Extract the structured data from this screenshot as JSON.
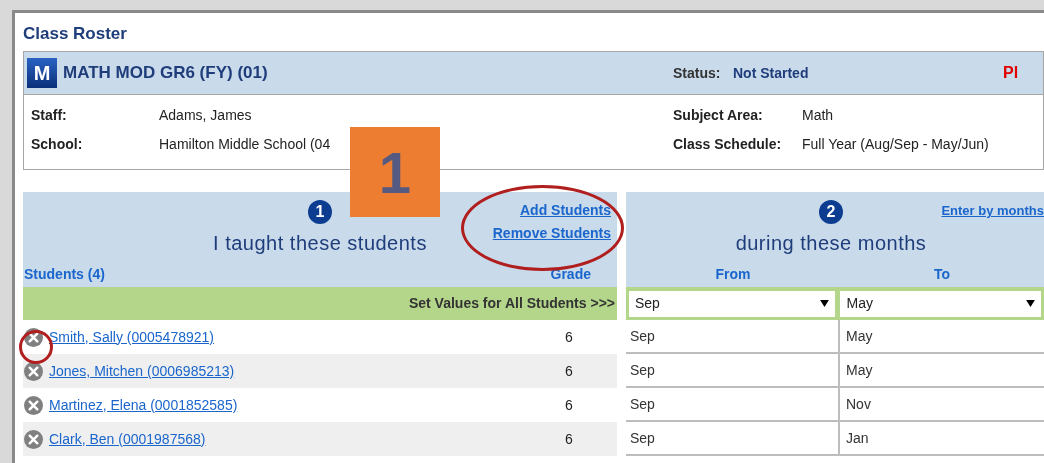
{
  "window": {
    "title": "Class Roster"
  },
  "class_header": {
    "icon_letter": "M",
    "name": "MATH MOD GR6 (FY) (01)",
    "status_label": "Status:",
    "status_value": "Not Started",
    "flag": "Pl"
  },
  "details_left": [
    {
      "label": "Staff:",
      "value": "Adams, James"
    },
    {
      "label": "School:",
      "value": "Hamilton Middle School (04"
    }
  ],
  "details_right": [
    {
      "label": "Subject Area:",
      "value": "Math"
    },
    {
      "label": "Class Schedule:",
      "value": "Full Year (Aug/Sep - May/Jun)"
    }
  ],
  "callout": "1",
  "students_panel": {
    "step": "1",
    "heading": "I taught these students",
    "links": [
      "Add Students",
      "Remove Students"
    ],
    "students_header": "Students (4)",
    "grade_header": "Grade",
    "set_all": "Set Values for All Students >>>"
  },
  "months_panel": {
    "step": "2",
    "heading": "during these months",
    "link": "Enter by months",
    "from_header": "From",
    "to_header": "To",
    "from_select": "Sep",
    "to_select": "May"
  },
  "students": [
    {
      "name": "Smith, Sally (0005478921)",
      "grade": "6",
      "from": "Sep",
      "to": "May"
    },
    {
      "name": "Jones, Mitchen (0006985213)",
      "grade": "6",
      "from": "Sep",
      "to": "May"
    },
    {
      "name": "Martinez, Elena (0001852585)",
      "grade": "6",
      "from": "Sep",
      "to": "Nov"
    },
    {
      "name": "Clark, Ben (0001987568)",
      "grade": "6",
      "from": "Sep",
      "to": "Jan"
    }
  ]
}
